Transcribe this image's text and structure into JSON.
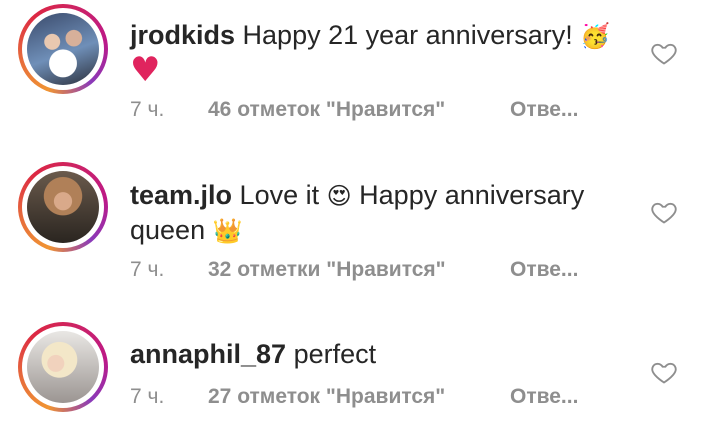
{
  "comments": [
    {
      "username": "jrodkids",
      "text": "Happy 21 year anniversary!",
      "emoji1": "🥳",
      "emoji2": "♥",
      "time": "7 ч.",
      "likes": "46 отметок \"Нравится\"",
      "reply": "Отве..."
    },
    {
      "username": "team.jlo",
      "text1": "Love it",
      "emoji1": "😍",
      "text2": "Happy anniversary",
      "text3": "queen",
      "emoji2": "👑",
      "time": "7 ч.",
      "likes": "32 отметки \"Нравится\"",
      "reply": "Отве..."
    },
    {
      "username": "annaphil_87",
      "text": "perfect",
      "time": "7 ч.",
      "likes": "27 отметок \"Нравится\"",
      "reply": "Отве..."
    }
  ],
  "icons": {
    "like": "heart-outline-icon"
  },
  "colors": {
    "text": "#262626",
    "secondary": "#8e8e8e",
    "heart_emoji": "#e0245e"
  }
}
